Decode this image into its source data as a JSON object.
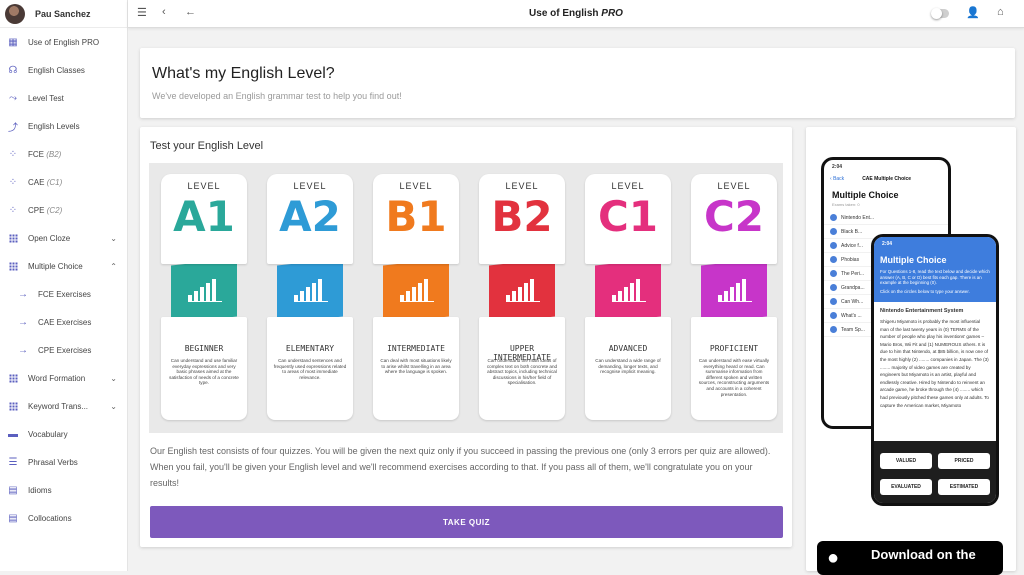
{
  "user": {
    "name": "Pau Sanchez"
  },
  "sidebar": {
    "items": [
      {
        "label": "Use of English PRO",
        "icon": "dashboard-icon"
      },
      {
        "label": "English Classes",
        "icon": "headphones-icon"
      },
      {
        "label": "Level Test",
        "icon": "trend-icon"
      },
      {
        "label": "English Levels",
        "icon": "trend-icon"
      },
      {
        "label": "FCE",
        "tag": "(B2)",
        "icon": "bubbles-icon"
      },
      {
        "label": "CAE",
        "tag": "(C1)",
        "icon": "bubbles-icon"
      },
      {
        "label": "CPE",
        "tag": "(C2)",
        "icon": "bubbles-icon"
      },
      {
        "label": "Open Cloze",
        "icon": "grid-icon"
      },
      {
        "label": "Multiple Choice",
        "icon": "grid-icon"
      },
      {
        "label": "FCE Exercises",
        "icon": "arrow-right-icon"
      },
      {
        "label": "CAE Exercises",
        "icon": "arrow-right-icon"
      },
      {
        "label": "CPE Exercises",
        "icon": "arrow-right-icon"
      },
      {
        "label": "Word Formation",
        "icon": "grid-icon"
      },
      {
        "label": "Keyword Trans...",
        "icon": "grid-icon"
      },
      {
        "label": "Vocabulary",
        "icon": "book-icon"
      },
      {
        "label": "Phrasal Verbs",
        "icon": "list-icon"
      },
      {
        "label": "Idioms",
        "icon": "notes-icon"
      },
      {
        "label": "Collocations",
        "icon": "notes-icon"
      }
    ]
  },
  "topbar": {
    "title": "Use of English",
    "title_em": "PRO"
  },
  "header": {
    "title": "What's my English Level?",
    "subtitle": "We've developed an English grammar test to help you find out!"
  },
  "main": {
    "title": "Test your English Level",
    "levels": [
      {
        "word": "LEVEL",
        "code": "A1",
        "name": "BEGINNER",
        "color": "#2aa89a",
        "desc": "Can understand and use familiar everyday expressions and very basic phrases aimed at the satisfaction of needs of a concrete type."
      },
      {
        "word": "LEVEL",
        "code": "A2",
        "name": "ELEMENTARY",
        "color": "#2e9bd6",
        "desc": "Can understand sentences and frequently used expressions related to areas of most immediate relevance."
      },
      {
        "word": "LEVEL",
        "code": "B1",
        "name": "INTERMEDIATE",
        "color": "#f07a1e",
        "desc": "Can deal with most situations likely to arise whilst travelling in an area where the language is spoken."
      },
      {
        "word": "LEVEL",
        "code": "B2",
        "name": "UPPER INTERMEDIATE",
        "color": "#e2323e",
        "desc": "Can understand the main ideas of complex text on both concrete and abstract topics, including technical discussions in his/her field of specialisation."
      },
      {
        "word": "LEVEL",
        "code": "C1",
        "name": "ADVANCED",
        "color": "#e42f7d",
        "desc": "Can understand a wide range of demanding, longer texts, and recognise implicit meaning."
      },
      {
        "word": "LEVEL",
        "code": "C2",
        "name": "PROFICIENT",
        "color": "#c735c9",
        "desc": "Can understand with ease virtually everything heard or read. Can summarise information from different spoken and written sources, reconstructing arguments and accounts in a coherent presentation."
      }
    ],
    "paragraph": "Our English test consists of four quizzes. You will be given the next quiz only if you succeed in passing the previous one (only 3 errors per quiz are allowed). When you fail, you'll be given your English level and we'll recommend exercises according to that. If you pass all of them, we'll congratulate you on your results!",
    "button": "TAKE QUIZ"
  },
  "promo": {
    "phone1": {
      "time": "2:04",
      "back": "Back",
      "nav_title": "CAE Multiple Choice",
      "heading": "Multiple Choice",
      "sub": "Exams taken: 0",
      "rows": [
        "Nintendo Ent...",
        "Black B...",
        "Advice f...",
        "Phobias",
        "The Peri...",
        "Grandpa...",
        "Can Wh...",
        "What's ...",
        "Team Sp..."
      ]
    },
    "phone2": {
      "time": "2:04",
      "heading": "Multiple Choice",
      "instructions": "For Questions 1-8, read the text below and decide which answer (A, B, C or D) best fits each gap. There is an example at the beginning (0).",
      "hint": "Click on the circles below to type your answer.",
      "text_title": "Nintendo Entertainment System",
      "text": "Shigeru Miyamoto is probably the most influential man of the last twenty years in (0) TERMS of the number of people who play his inventions' games – Mario Bros, Wii Fit and (1) NUMEROUS others. It is due to him that Nintendo, at $85 billion, is now one of the most highly (2) ........ companies in Japan. The (3) ........ majority of video games are created by engineers but Miyamoto is an artist, playful and endlessly creative. Hired by Nintendo to reinvent an arcade game, he broke through the (4) ........ which had previously pitched these games only at adults. To capture the American market, Miyamoto",
      "options": [
        "VALUED",
        "PRICED",
        "EVALUATED",
        "ESTIMATED"
      ]
    },
    "store": "Download on the"
  }
}
